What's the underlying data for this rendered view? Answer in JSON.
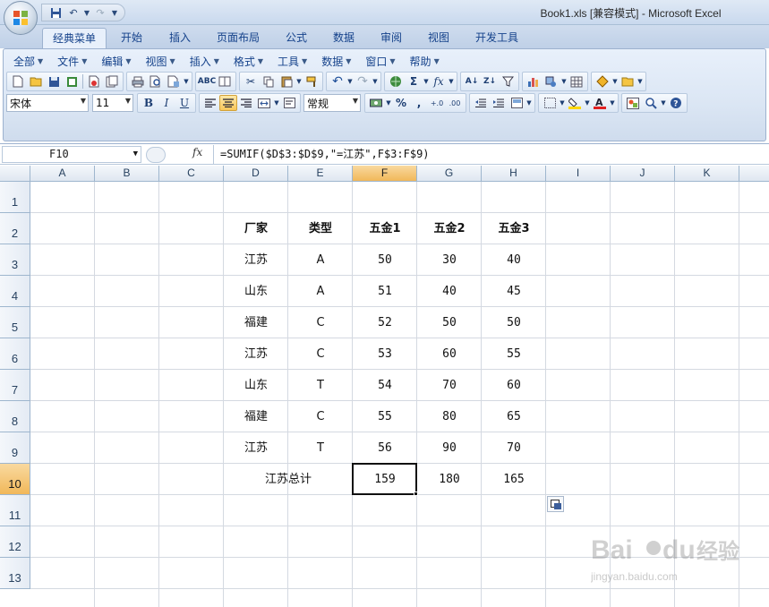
{
  "window": {
    "title": "Book1.xls  [兼容模式] - Microsoft Excel"
  },
  "ribbon_tabs": [
    "经典菜单",
    "开始",
    "插入",
    "页面布局",
    "公式",
    "数据",
    "审阅",
    "视图",
    "开发工具"
  ],
  "active_tab": "经典菜单",
  "classic_menu": [
    "全部",
    "文件",
    "编辑",
    "视图",
    "插入",
    "格式",
    "工具",
    "数据",
    "窗口",
    "帮助"
  ],
  "format": {
    "font_name": "宋体",
    "font_size": "11",
    "number_format": "常规"
  },
  "formula_bar": {
    "name_box": "F10",
    "fx_label": "fx",
    "formula": "=SUMIF($D$3:$D$9,\"=江苏\",F$3:F$9)"
  },
  "sheet": {
    "columns": [
      "A",
      "B",
      "C",
      "D",
      "E",
      "F",
      "G",
      "H",
      "I",
      "J",
      "K"
    ],
    "rows": [
      "1",
      "2",
      "3",
      "4",
      "5",
      "6",
      "7",
      "8",
      "9",
      "10",
      "11",
      "12",
      "13"
    ],
    "selected_column": "F",
    "selected_row": "10",
    "selected_cell": "F10"
  },
  "table": {
    "headers": [
      "厂家",
      "类型",
      "五金1",
      "五金2",
      "五金3"
    ],
    "rows": [
      [
        "江苏",
        "A",
        "50",
        "30",
        "40"
      ],
      [
        "山东",
        "A",
        "51",
        "40",
        "45"
      ],
      [
        "福建",
        "C",
        "52",
        "50",
        "50"
      ],
      [
        "江苏",
        "C",
        "53",
        "60",
        "55"
      ],
      [
        "山东",
        "T",
        "54",
        "70",
        "60"
      ],
      [
        "福建",
        "C",
        "55",
        "80",
        "65"
      ],
      [
        "江苏",
        "T",
        "56",
        "90",
        "70"
      ]
    ],
    "total_label": "江苏总计",
    "totals": [
      "159",
      "180",
      "165"
    ]
  },
  "watermark": {
    "brand": "Bai du 经验",
    "url": "jingyan.baidu.com"
  },
  "colors": {
    "selected_header": "#f1b85a",
    "ribbon_text": "#15428b",
    "grid_line": "#d4d9e1"
  }
}
